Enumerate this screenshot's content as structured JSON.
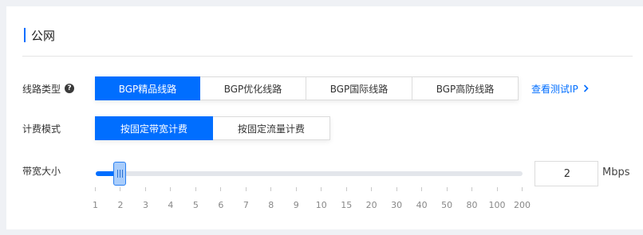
{
  "section": {
    "title": "公网"
  },
  "line_type": {
    "label": "线路类型",
    "help_icon": "question-circle-icon",
    "options": [
      "BGP精品线路",
      "BGP优化线路",
      "BGP国际线路",
      "BGP高防线路"
    ],
    "selected_index": 0,
    "link_label": "查看测试IP",
    "link_icon": "chevron-right-icon"
  },
  "billing": {
    "label": "计费模式",
    "options": [
      "按固定带宽计费",
      "按固定流量计费"
    ],
    "selected_index": 0
  },
  "bandwidth": {
    "label": "带宽大小",
    "value": "2",
    "unit": "Mbps",
    "ticks": [
      "1",
      "2",
      "3",
      "4",
      "5",
      "6",
      "7",
      "8",
      "9",
      "10",
      "15",
      "20",
      "30",
      "40",
      "50",
      "80",
      "100",
      "200"
    ],
    "selected_tick_index": 1
  },
  "colors": {
    "accent": "#006eff",
    "handle": "#a9cdfb"
  }
}
